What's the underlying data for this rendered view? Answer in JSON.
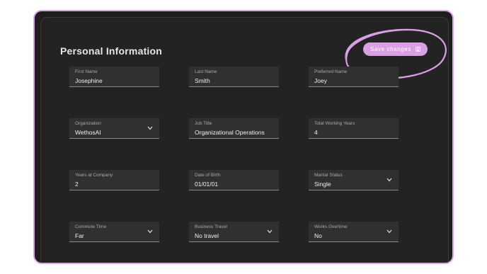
{
  "page": {
    "title": "Personal Information",
    "save_label": "Save changes"
  },
  "fields": [
    {
      "label": "First Name",
      "value": "Josephine",
      "dropdown": false
    },
    {
      "label": "Last Name",
      "value": "Smith",
      "dropdown": false
    },
    {
      "label": "Preferred Name",
      "value": "Joey",
      "dropdown": false
    },
    {
      "label": "Organization",
      "value": "WethosAI",
      "dropdown": true
    },
    {
      "label": "Job Title",
      "value": "Organizational Operations",
      "dropdown": false
    },
    {
      "label": "Total Working Years",
      "value": "4",
      "dropdown": false
    },
    {
      "label": "Years at Company",
      "value": "2",
      "dropdown": false
    },
    {
      "label": "Date of Birth",
      "value": "01/01/01",
      "dropdown": false
    },
    {
      "label": "Marital Status",
      "value": "Single",
      "dropdown": true
    },
    {
      "label": "Commute Time",
      "value": "Far",
      "dropdown": true
    },
    {
      "label": "Business Travel",
      "value": "No travel",
      "dropdown": true
    },
    {
      "label": "Works Overtime",
      "value": "No",
      "dropdown": true
    }
  ],
  "colors": {
    "accent": "#d9a0e3",
    "panel": "#232323",
    "field_bg": "#303030"
  }
}
